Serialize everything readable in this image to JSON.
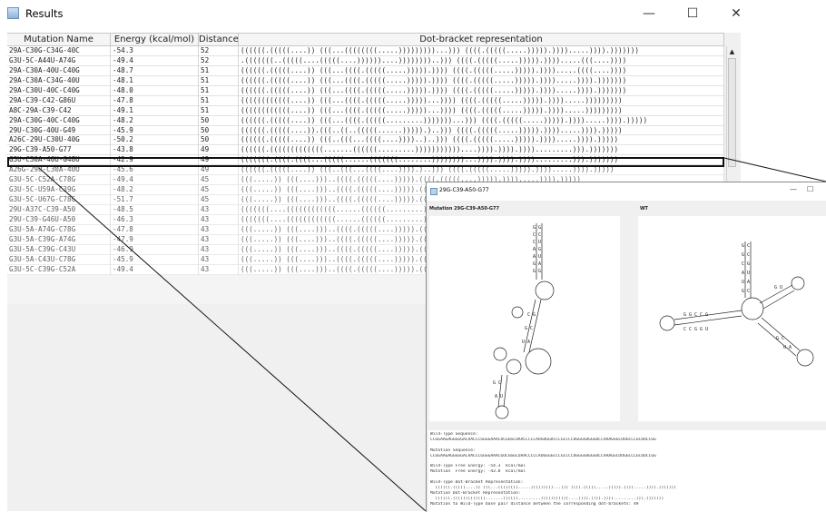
{
  "window": {
    "title": "Results",
    "minimize": "—",
    "maximize": "☐",
    "close": "✕"
  },
  "table": {
    "columns": [
      "Mutation Name",
      "Energy (kcal/mol)",
      "Distance",
      "Dot-bracket representation"
    ],
    "rows": [
      [
        "29A-C30G-C34G-40C",
        "-54.3",
        "52",
        "((((((.(((((....)) (((...((((((((.....)))))))))...))) ((((.(((((.....))))).)))).....)))).)))))))"
      ],
      [
        "G3U-5C-A44U-A74G",
        "-49.4",
        "52",
        ".(((((((..(((((....(((((....))))))....))))))))..))) ((((.(((((.....))))).)))).....(((....))))"
      ],
      [
        "29A-C30A-40U-C40G",
        "-48.7",
        "51",
        "((((((.(((((....)) (((...((((.(((((.....))))).)))) ((((.(((((.....))))).)))).....((((....))))"
      ],
      [
        "29A-C30A-C34G-40U",
        "-48.1",
        "51",
        "((((((.(((((....)) (((...((((.(((((.....))))).)))) ((((.(((((.....))))).)))).....)))).)))))))"
      ],
      [
        "29A-C30U-40C-C40G",
        "-48.0",
        "51",
        "((((((.(((((....)) (((...((((.(((((.....))))).)))) ((((.(((((.....))))).)))).....)))).)))))))"
      ],
      [
        "29A-C39-C42-G86U",
        "-47.8",
        "51",
        "((((((((((((....)) (((...((((.(((((.....)))))...)))) ((((.(((((.....))))).)))).....)))))))))"
      ],
      [
        "A8C-29A-C39-C42",
        "-49.1",
        "51",
        "((((((((((((....)) (((...((((.(((((.....)))))...)))) ((((.(((((.....))))).)))).....)))))))))"
      ],
      [
        "29A-C30G-40C-C40G",
        "-48.2",
        "50",
        "((((((.(((((....)) (((...((((.(((((.........)))))))...))) ((((.(((((.....))))).)))).....)))).)))))"
      ],
      [
        "29U-C30G-40U-G49",
        "-45.9",
        "50",
        "((((((.(((((....)).(((..((..(((((......))))).)..))) ((((.(((((.....))))).)))).....)))).)))))"
      ],
      [
        "A26C-29U-C30U-40G",
        "-50.2",
        "50",
        "((((((.(((((....)) (((..(((...((((....))))..)..))) ((((.(((((.....))))).)))).....)))).)))))"
      ],
      [
        "29G-C39-A50-G77",
        "-43.8",
        "49",
        "((((((.(((((((((((((.......((((((.........)))))))))))....)))).)))).)))).........))).)))))))"
      ],
      [
        "G3U-C30A-40U-G48U",
        "-42.9",
        "49",
        "(((((((.((((.((((...(((((......(((((((........))))))))...)))).)))).)))).........))).)))))))"
      ],
      [
        "A26G-29U-C30A-40U",
        "-45.6",
        "49",
        "((((((.(((((....)) (((..(((...((((....)))).)..))) ((((.(((((.....))))).)))).....)))).)))))"
      ],
      [
        "G3U-5C-C52A-C78G",
        "-49.4",
        "45",
        "(((.....)) (((....)))..((((.(((((....))))).((((.(((((....))))).)))).....)))).)))))"
      ],
      [
        "G3U-5C-U59A-C39G",
        "-48.2",
        "45",
        "(((.....)) (((....)))..((((.(((((....))))).((((.(((((....))))).)))).....)))).)))))"
      ],
      [
        "G3U-5C-U67G-C78G",
        "-51.7",
        "45",
        "(((.....)) (((....)))..((((.(((((....))))).((((.(((((....))))).)))).....)))).)))))"
      ],
      [
        "29U-A37C-C39-A50",
        "-48.5",
        "43",
        "(((((((....((((((((((((......((((((.........))))))....))))).)))).)))))).)))))"
      ],
      [
        "29U-C39-G46U-A50",
        "-46.3",
        "43",
        "(((((((....((((((((((((......((((((.........))))))....))))).)))).)))))).)))))"
      ],
      [
        "G3U-5A-A74G-C78G",
        "-47.8",
        "43",
        "(((.....)) (((....)))..((((.(((((....))))).((((.(((((....))))).)))).....)))).)))))"
      ],
      [
        "G3U-5A-C39G-A74G",
        "-47.9",
        "43",
        "(((.....)) (((....)))..((((.(((((....))))).((((.(((((....))))).)))).....)))).)))))"
      ],
      [
        "G3U-5A-C39G-C43U",
        "-46.9",
        "43",
        "(((.....)) (((....)))..((((.(((((....))))).((((.(((((....))))).)))).....)))).)))))"
      ],
      [
        "G3U-5A-C43U-C78G",
        "-45.9",
        "43",
        "(((.....)) (((....)))..((((.(((((....))))).((((.(((((....))))).)))).....)))).)))))"
      ],
      [
        "G3U-5C-C39G-C52A",
        "-49.4",
        "43",
        "(((.....)) (((....)))..((((.(((((....))))).((((.(((((....))))).)))).....)))).)))))"
      ]
    ]
  },
  "inset": {
    "title": "29G-C39-A50-G77",
    "mutation_label": "Mutation 29G-C39-A50-G77",
    "wt_label": "WT",
    "info_lines": [
      "Wild-Type Sequence:",
      "CCGGAAGAGGGGGACAACCCGGGGAAACUCGGGCUAACCCCCAUGUGGACCCGCCCCUGGGGUGGGUCCAAAGGGCUUGCCCGCUUCCGG",
      "",
      "Mutation Sequence:",
      "CCGGAAGAGGGGGACAACCCGGGGAAACGUCGGGCUAACCCCCAUGGGGCCCGCCCCUGGGGUGGGUCCAAAGGCUUGGCCCGCUUCCGG",
      "",
      "Wild-Type Free Energy: -54.3  kcal/mol",
      "Mutation  Free Energy: -43.8  kcal/mol",
      "",
      "Wild-Type Dot-Bracket Representation:",
      "  ((((((.(((((....)) (((...((((((((.....)))))))))...))) ((((.(((((.....))))).)))).....)))).)))))))",
      "Mutation Dot-Bracket Representation:",
      "  ((((((.(((((((((((((.......((((((.........)))))))))))....)))).)))).)))).........))).)))))))",
      "Mutation to Wild-Type base pair distance between the corresponding dot-brackets: 49"
    ]
  }
}
